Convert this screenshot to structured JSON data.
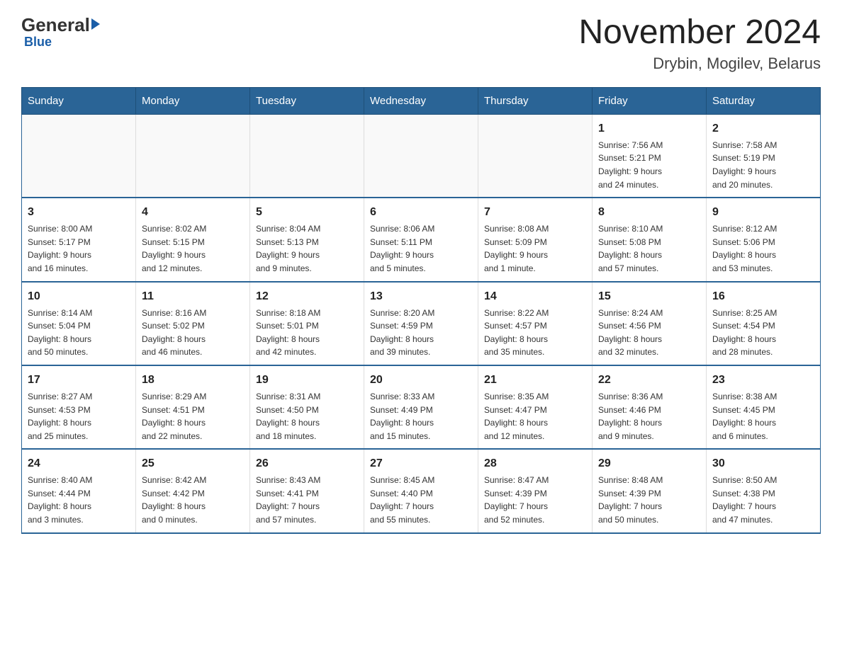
{
  "header": {
    "logo_general": "General",
    "logo_blue": "Blue",
    "month_year": "November 2024",
    "location": "Drybin, Mogilev, Belarus"
  },
  "weekdays": [
    "Sunday",
    "Monday",
    "Tuesday",
    "Wednesday",
    "Thursday",
    "Friday",
    "Saturday"
  ],
  "weeks": [
    [
      {
        "day": "",
        "info": ""
      },
      {
        "day": "",
        "info": ""
      },
      {
        "day": "",
        "info": ""
      },
      {
        "day": "",
        "info": ""
      },
      {
        "day": "",
        "info": ""
      },
      {
        "day": "1",
        "info": "Sunrise: 7:56 AM\nSunset: 5:21 PM\nDaylight: 9 hours\nand 24 minutes."
      },
      {
        "day": "2",
        "info": "Sunrise: 7:58 AM\nSunset: 5:19 PM\nDaylight: 9 hours\nand 20 minutes."
      }
    ],
    [
      {
        "day": "3",
        "info": "Sunrise: 8:00 AM\nSunset: 5:17 PM\nDaylight: 9 hours\nand 16 minutes."
      },
      {
        "day": "4",
        "info": "Sunrise: 8:02 AM\nSunset: 5:15 PM\nDaylight: 9 hours\nand 12 minutes."
      },
      {
        "day": "5",
        "info": "Sunrise: 8:04 AM\nSunset: 5:13 PM\nDaylight: 9 hours\nand 9 minutes."
      },
      {
        "day": "6",
        "info": "Sunrise: 8:06 AM\nSunset: 5:11 PM\nDaylight: 9 hours\nand 5 minutes."
      },
      {
        "day": "7",
        "info": "Sunrise: 8:08 AM\nSunset: 5:09 PM\nDaylight: 9 hours\nand 1 minute."
      },
      {
        "day": "8",
        "info": "Sunrise: 8:10 AM\nSunset: 5:08 PM\nDaylight: 8 hours\nand 57 minutes."
      },
      {
        "day": "9",
        "info": "Sunrise: 8:12 AM\nSunset: 5:06 PM\nDaylight: 8 hours\nand 53 minutes."
      }
    ],
    [
      {
        "day": "10",
        "info": "Sunrise: 8:14 AM\nSunset: 5:04 PM\nDaylight: 8 hours\nand 50 minutes."
      },
      {
        "day": "11",
        "info": "Sunrise: 8:16 AM\nSunset: 5:02 PM\nDaylight: 8 hours\nand 46 minutes."
      },
      {
        "day": "12",
        "info": "Sunrise: 8:18 AM\nSunset: 5:01 PM\nDaylight: 8 hours\nand 42 minutes."
      },
      {
        "day": "13",
        "info": "Sunrise: 8:20 AM\nSunset: 4:59 PM\nDaylight: 8 hours\nand 39 minutes."
      },
      {
        "day": "14",
        "info": "Sunrise: 8:22 AM\nSunset: 4:57 PM\nDaylight: 8 hours\nand 35 minutes."
      },
      {
        "day": "15",
        "info": "Sunrise: 8:24 AM\nSunset: 4:56 PM\nDaylight: 8 hours\nand 32 minutes."
      },
      {
        "day": "16",
        "info": "Sunrise: 8:25 AM\nSunset: 4:54 PM\nDaylight: 8 hours\nand 28 minutes."
      }
    ],
    [
      {
        "day": "17",
        "info": "Sunrise: 8:27 AM\nSunset: 4:53 PM\nDaylight: 8 hours\nand 25 minutes."
      },
      {
        "day": "18",
        "info": "Sunrise: 8:29 AM\nSunset: 4:51 PM\nDaylight: 8 hours\nand 22 minutes."
      },
      {
        "day": "19",
        "info": "Sunrise: 8:31 AM\nSunset: 4:50 PM\nDaylight: 8 hours\nand 18 minutes."
      },
      {
        "day": "20",
        "info": "Sunrise: 8:33 AM\nSunset: 4:49 PM\nDaylight: 8 hours\nand 15 minutes."
      },
      {
        "day": "21",
        "info": "Sunrise: 8:35 AM\nSunset: 4:47 PM\nDaylight: 8 hours\nand 12 minutes."
      },
      {
        "day": "22",
        "info": "Sunrise: 8:36 AM\nSunset: 4:46 PM\nDaylight: 8 hours\nand 9 minutes."
      },
      {
        "day": "23",
        "info": "Sunrise: 8:38 AM\nSunset: 4:45 PM\nDaylight: 8 hours\nand 6 minutes."
      }
    ],
    [
      {
        "day": "24",
        "info": "Sunrise: 8:40 AM\nSunset: 4:44 PM\nDaylight: 8 hours\nand 3 minutes."
      },
      {
        "day": "25",
        "info": "Sunrise: 8:42 AM\nSunset: 4:42 PM\nDaylight: 8 hours\nand 0 minutes."
      },
      {
        "day": "26",
        "info": "Sunrise: 8:43 AM\nSunset: 4:41 PM\nDaylight: 7 hours\nand 57 minutes."
      },
      {
        "day": "27",
        "info": "Sunrise: 8:45 AM\nSunset: 4:40 PM\nDaylight: 7 hours\nand 55 minutes."
      },
      {
        "day": "28",
        "info": "Sunrise: 8:47 AM\nSunset: 4:39 PM\nDaylight: 7 hours\nand 52 minutes."
      },
      {
        "day": "29",
        "info": "Sunrise: 8:48 AM\nSunset: 4:39 PM\nDaylight: 7 hours\nand 50 minutes."
      },
      {
        "day": "30",
        "info": "Sunrise: 8:50 AM\nSunset: 4:38 PM\nDaylight: 7 hours\nand 47 minutes."
      }
    ]
  ]
}
